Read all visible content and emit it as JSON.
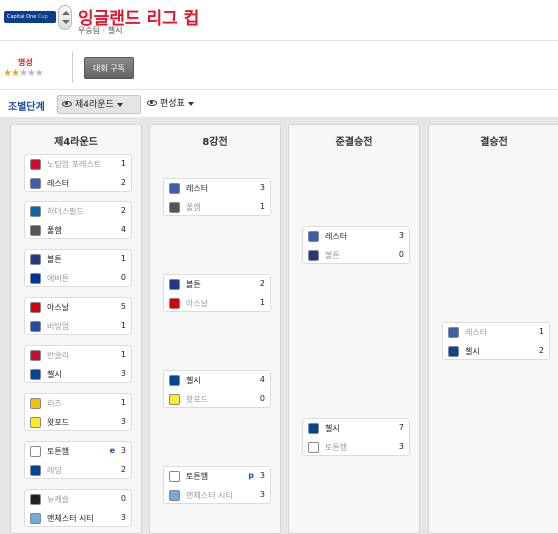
{
  "header": {
    "logo_text": "Capital One",
    "logo_cup": "Cup",
    "title": "잉글랜드 리그 컵",
    "subtitle": "우승팀 · 첼시"
  },
  "infobar": {
    "fame_label": "명성",
    "fame_stars": 2,
    "fame_max": 5,
    "subscribe_label": "대회 구독"
  },
  "filters": {
    "stage_label": "조별단계",
    "round_label": "제4라운드",
    "format_label": "편성표"
  },
  "colors": {
    "title_red": "#e4142b",
    "link_blue": "#1b4fa3",
    "star_gold": "#e7a71e"
  },
  "columns": [
    {
      "title": "제4라운드",
      "matches": [
        {
          "home": {
            "name": "노팅엄 포레스트",
            "score": "1",
            "win": false,
            "crest": "#c8102e"
          },
          "away": {
            "name": "레스터",
            "score": "2",
            "win": true,
            "crest": "#3b5fb0"
          }
        },
        {
          "home": {
            "name": "허더스필드",
            "score": "2",
            "win": false,
            "crest": "#0e63ad"
          },
          "away": {
            "name": "풀햄",
            "score": "4",
            "win": true,
            "crest": "#555555"
          }
        },
        {
          "home": {
            "name": "볼튼",
            "score": "1",
            "win": true,
            "crest": "#1d3b8a"
          },
          "away": {
            "name": "에버튼",
            "score": "0",
            "win": false,
            "crest": "#003399"
          }
        },
        {
          "home": {
            "name": "아스날",
            "score": "5",
            "win": true,
            "crest": "#db0007"
          },
          "away": {
            "name": "버밍엄",
            "score": "1",
            "win": false,
            "crest": "#1f4ea3"
          }
        },
        {
          "home": {
            "name": "반슬리",
            "score": "1",
            "win": false,
            "crest": "#c8102e"
          },
          "away": {
            "name": "첼시",
            "score": "3",
            "win": true,
            "crest": "#034694"
          }
        },
        {
          "home": {
            "name": "리즈",
            "score": "1",
            "win": false,
            "crest": "#f5c400"
          },
          "away": {
            "name": "왓포드",
            "score": "3",
            "win": true,
            "crest": "#fbee23"
          }
        },
        {
          "home": {
            "name": "토튼햄",
            "score": "3",
            "pen": "e",
            "win": true,
            "crest": "#ffffff"
          },
          "away": {
            "name": "레딩",
            "score": "2",
            "win": false,
            "crest": "#004494"
          }
        },
        {
          "home": {
            "name": "뉴캐슬",
            "score": "0",
            "win": false,
            "crest": "#222222"
          },
          "away": {
            "name": "맨체스터 시티",
            "score": "3",
            "win": true,
            "crest": "#6cabdd"
          }
        }
      ]
    },
    {
      "title": "8강전",
      "matches": [
        {
          "home": {
            "name": "레스터",
            "score": "3",
            "win": true,
            "crest": "#3b5fb0"
          },
          "away": {
            "name": "풀햄",
            "score": "1",
            "win": false,
            "crest": "#555555"
          }
        },
        {
          "home": {
            "name": "볼튼",
            "score": "2",
            "win": true,
            "crest": "#1d3b8a"
          },
          "away": {
            "name": "아스날",
            "score": "1",
            "win": false,
            "crest": "#db0007"
          }
        },
        {
          "home": {
            "name": "첼시",
            "score": "4",
            "win": true,
            "crest": "#034694"
          },
          "away": {
            "name": "왓포드",
            "score": "0",
            "win": false,
            "crest": "#fbee23"
          }
        },
        {
          "home": {
            "name": "토튼햄",
            "score": "3",
            "pen": "p",
            "win": true,
            "crest": "#ffffff"
          },
          "away": {
            "name": "맨체스터 시티",
            "score": "3",
            "win": false,
            "crest": "#6cabdd"
          }
        }
      ]
    },
    {
      "title": "준결승전",
      "matches": [
        {
          "home": {
            "name": "레스터",
            "score": "3",
            "win": true,
            "crest": "#3b5fb0"
          },
          "away": {
            "name": "볼튼",
            "score": "0",
            "win": false,
            "crest": "#1d3b8a"
          }
        },
        {
          "home": {
            "name": "첼시",
            "score": "7",
            "win": true,
            "crest": "#034694"
          },
          "away": {
            "name": "토튼햄",
            "score": "3",
            "win": false,
            "crest": "#ffffff"
          }
        }
      ]
    },
    {
      "title": "결승전",
      "matches": [
        {
          "home": {
            "name": "레스터",
            "score": "1",
            "win": false,
            "crest": "#3b5fb0"
          },
          "away": {
            "name": "첼시",
            "score": "2",
            "win": true,
            "crest": "#034694"
          }
        }
      ]
    }
  ]
}
